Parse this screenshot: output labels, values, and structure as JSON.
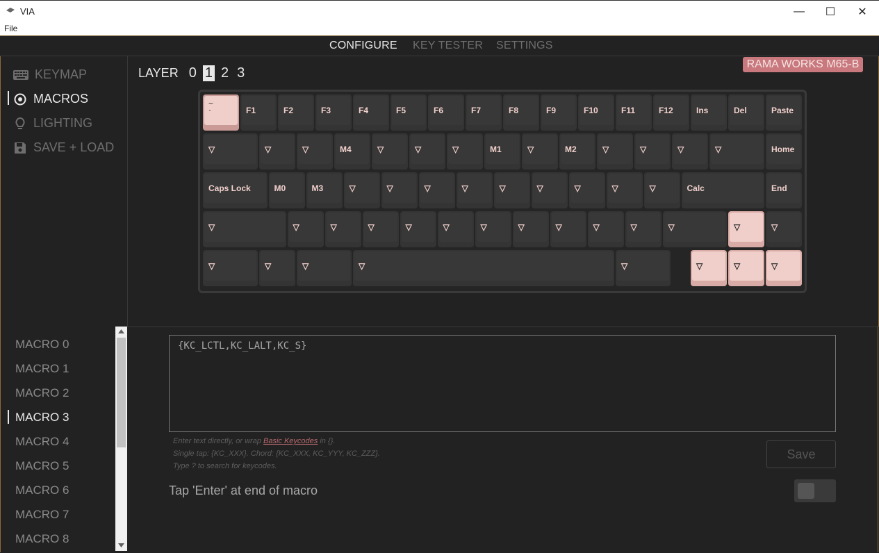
{
  "window": {
    "title": "VIA",
    "minimize": "—",
    "maximize": "☐",
    "close": "✕"
  },
  "menu": {
    "file": "File"
  },
  "tabs": [
    {
      "label": "CONFIGURE",
      "active": true
    },
    {
      "label": "KEY TESTER",
      "active": false
    },
    {
      "label": "SETTINGS",
      "active": false
    }
  ],
  "nav": [
    {
      "label": "KEYMAP",
      "icon": "keyboard-icon",
      "active": false
    },
    {
      "label": "MACROS",
      "icon": "target-icon",
      "active": true
    },
    {
      "label": "LIGHTING",
      "icon": "lightbulb-icon",
      "active": false
    },
    {
      "label": "SAVE + LOAD",
      "icon": "floppy-disk-icon",
      "active": false
    }
  ],
  "layers": {
    "label": "LAYER",
    "items": [
      "0",
      "1",
      "2",
      "3"
    ],
    "selected": "1"
  },
  "device": {
    "name": "RAMA WORKS M65-B",
    "badge_color": "#c9787d"
  },
  "keyboard": {
    "rows": [
      [
        "~\n`",
        "F1",
        "F2",
        "F3",
        "F4",
        "F5",
        "F6",
        "F7",
        "F8",
        "F9",
        "F10",
        "F11",
        "F12",
        "Ins",
        "Del",
        "Paste"
      ],
      [
        "▽",
        "▽",
        "▽",
        "M4",
        "▽",
        "▽",
        "▽",
        "M1",
        "▽",
        "M2",
        "▽",
        "▽",
        "▽",
        "▽",
        "Home"
      ],
      [
        "Caps Lock",
        "M0",
        "M3",
        "▽",
        "▽",
        "▽",
        "▽",
        "▽",
        "▽",
        "▽",
        "▽",
        "▽",
        "Calc",
        "End"
      ],
      [
        "▽",
        "▽",
        "▽",
        "▽",
        "▽",
        "▽",
        "▽",
        "▽",
        "▽",
        "▽",
        "▽",
        "▽",
        "▽",
        "▽"
      ],
      [
        "▽",
        "▽",
        "▽",
        "▽",
        "▽",
        "▽",
        "▽",
        "▽"
      ]
    ]
  },
  "macros": {
    "items": [
      "MACRO 0",
      "MACRO 1",
      "MACRO 2",
      "MACRO 3",
      "MACRO 4",
      "MACRO 5",
      "MACRO 6",
      "MACRO 7",
      "MACRO 8"
    ],
    "selected": "MACRO 3",
    "editor_value": "{KC_LCTL,KC_LALT,KC_S}",
    "help_line1_pre": "Enter text directly, or wrap ",
    "help_line1_link": "Basic Keycodes",
    "help_line1_post": " in {}.",
    "help_line2": "Single tap: {KC_XXX}. Chord: {KC_XXX, KC_YYY, KC_ZZZ}.",
    "help_line3": "Type ? to search for keycodes.",
    "save_label": "Save",
    "enter_label": "Tap 'Enter' at end of macro",
    "enter_toggle_on": false
  }
}
